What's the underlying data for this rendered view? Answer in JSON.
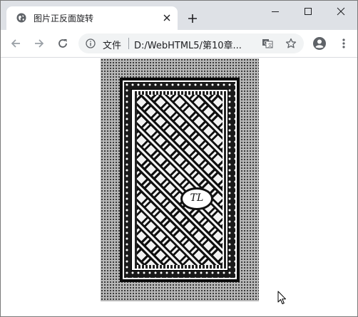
{
  "tab": {
    "title": "图片正反面旋转",
    "favicon_icon": "globe-icon",
    "close_icon": "close-icon"
  },
  "new_tab_icon": "plus-icon",
  "window_controls": {
    "minimize_icon": "minimize-icon",
    "maximize_icon": "maximize-icon",
    "close_icon": "close-icon"
  },
  "toolbar": {
    "back_icon": "back-arrow-icon",
    "forward_icon": "forward-arrow-icon",
    "reload_icon": "reload-icon"
  },
  "omnibox": {
    "info_icon": "info-icon",
    "scheme_label": "文件",
    "url": "D:/WebHTML5/第10章...",
    "translate_icon": "translate-icon",
    "bookmark_icon": "star-icon"
  },
  "profile_icon": "account-icon",
  "menu_icon": "more-vert-icon",
  "page": {
    "card_emblem": "TL",
    "cursor_icon": "mouse-pointer-icon"
  },
  "colors": {
    "tabstrip_bg": "#dee1e6",
    "omnibox_bg": "#f1f3f4",
    "page_bg": "#ffffff"
  }
}
